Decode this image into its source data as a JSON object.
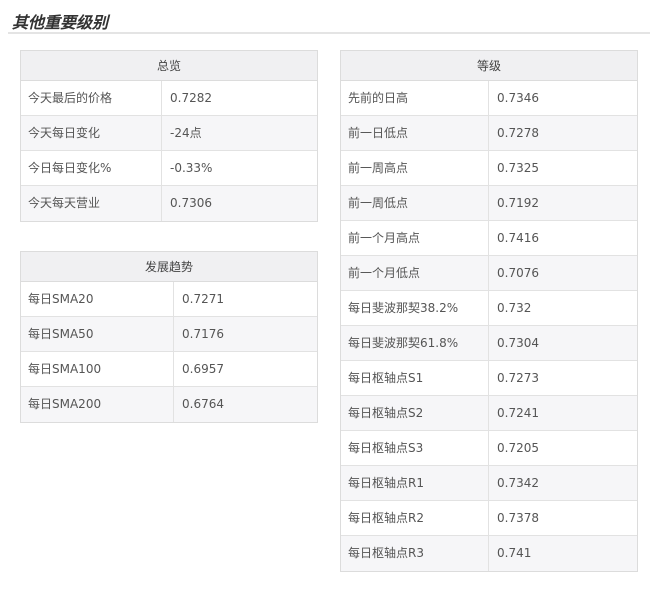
{
  "page": {
    "title": "其他重要级别"
  },
  "overview": {
    "title": "总览",
    "rows": [
      {
        "label": "今天最后的价格",
        "value": "0.7282"
      },
      {
        "label": "今天每日变化",
        "value": "-24点"
      },
      {
        "label": "今日每日变化%",
        "value": "-0.33%"
      },
      {
        "label": "今天每天营业",
        "value": "0.7306"
      }
    ]
  },
  "trend": {
    "title": "发展趋势",
    "rows": [
      {
        "label": "每日SMA20",
        "value": "0.7271"
      },
      {
        "label": "每日SMA50",
        "value": "0.7176"
      },
      {
        "label": "每日SMA100",
        "value": "0.6957"
      },
      {
        "label": "每日SMA200",
        "value": "0.6764"
      }
    ]
  },
  "levels": {
    "title": "等级",
    "rows": [
      {
        "label": "先前的日高",
        "value": "0.7346"
      },
      {
        "label": "前一日低点",
        "value": "0.7278"
      },
      {
        "label": "前一周高点",
        "value": "0.7325"
      },
      {
        "label": "前一周低点",
        "value": "0.7192"
      },
      {
        "label": "前一个月高点",
        "value": "0.7416"
      },
      {
        "label": "前一个月低点",
        "value": "0.7076"
      },
      {
        "label": "每日斐波那契38.2%",
        "value": "0.732"
      },
      {
        "label": "每日斐波那契61.8%",
        "value": "0.7304"
      },
      {
        "label": "每日枢轴点S1",
        "value": "0.7273"
      },
      {
        "label": "每日枢轴点S2",
        "value": "0.7241"
      },
      {
        "label": "每日枢轴点S3",
        "value": "0.7205"
      },
      {
        "label": "每日枢轴点R1",
        "value": "0.7342"
      },
      {
        "label": "每日枢轴点R2",
        "value": "0.7378"
      },
      {
        "label": "每日枢轴点R3",
        "value": "0.741"
      }
    ]
  }
}
